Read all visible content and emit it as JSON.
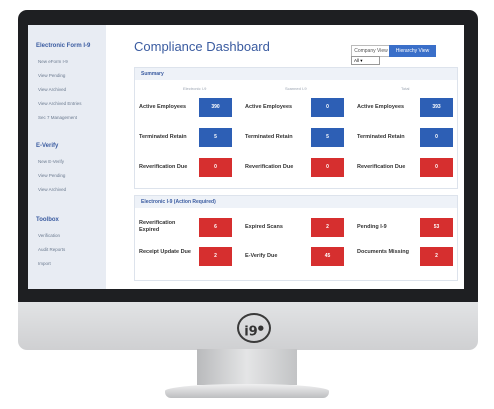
{
  "sidebar": {
    "sections": [
      {
        "title": "Electronic Form I-9",
        "items": [
          "New eForm I-9",
          "View Pending",
          "View Archived",
          "View Archived Entries",
          "Sec 7 Management"
        ]
      },
      {
        "title": "E-Verify",
        "items": [
          "New E-Verify",
          "View Pending",
          "View Archived"
        ]
      },
      {
        "title": "Toolbox",
        "items": [
          "Verification",
          "Audit Reports",
          "Import"
        ]
      }
    ]
  },
  "header": {
    "title": "Compliance Dashboard",
    "company_view": "Company View",
    "hierarchy_view": "Hierarchy View",
    "filter_value": "All"
  },
  "summary": {
    "heading": "Summary",
    "columns": [
      "Electronic I-9",
      "Scanned I-9",
      "Total"
    ],
    "rows": [
      {
        "label": "Active Employees",
        "values": [
          "390",
          "0",
          "393"
        ]
      },
      {
        "label": "Terminated Retain",
        "values": [
          "5",
          "5",
          "0"
        ]
      },
      {
        "label": "Reverification Due",
        "values": [
          "0",
          "0",
          "0"
        ]
      }
    ]
  },
  "action": {
    "heading": "Electronic I-9 (Action Required)",
    "items": [
      {
        "label": "Reverification Expired",
        "value": "6"
      },
      {
        "label": "Expired Scans",
        "value": "2"
      },
      {
        "label": "Pending I-9",
        "value": "53"
      },
      {
        "label": "Receipt Update Due",
        "value": "2"
      },
      {
        "label": "E-Verify Due",
        "value": "45"
      },
      {
        "label": "Documents Missing",
        "value": "2"
      }
    ]
  },
  "logo_text": "i9",
  "colors": {
    "accent": "#3a5ba0",
    "tile_blue": "#2d5fb5",
    "tile_red": "#d62f2f"
  }
}
